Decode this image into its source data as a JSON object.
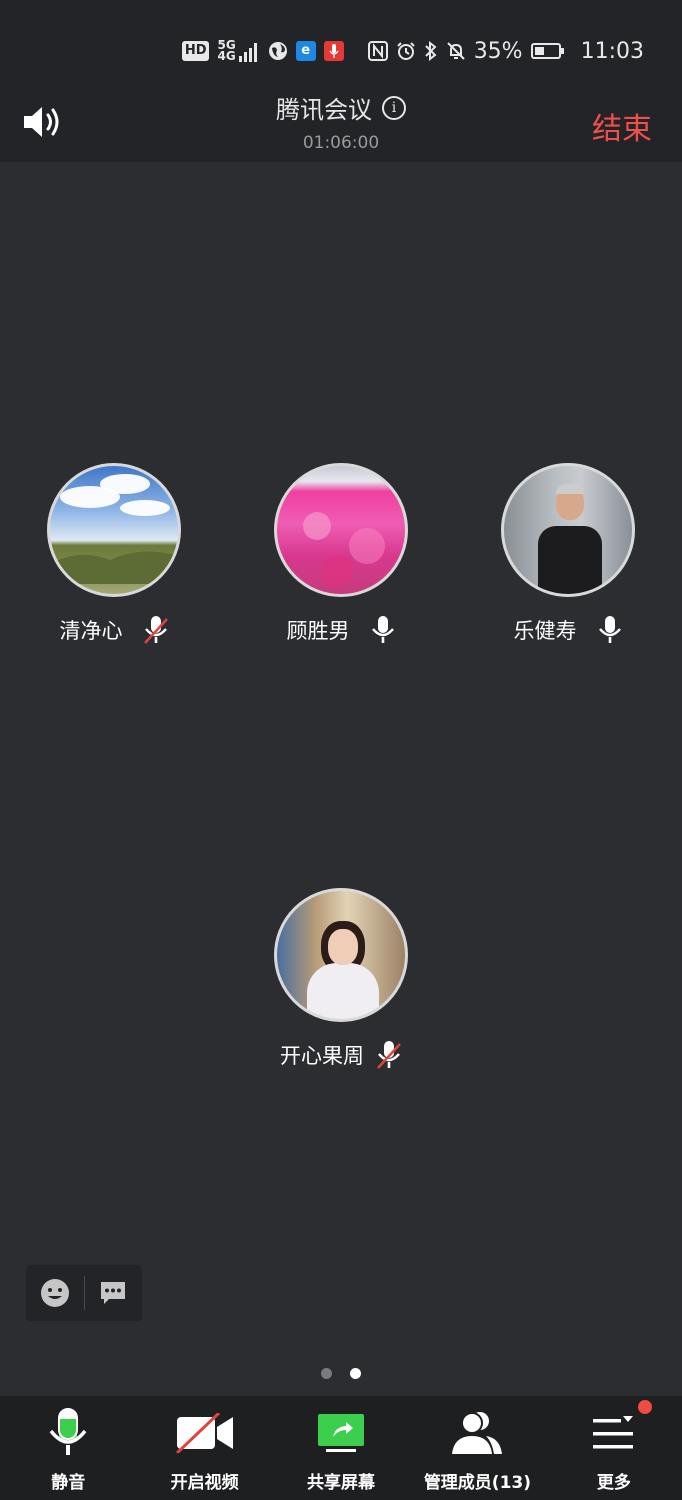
{
  "status_bar": {
    "hd": "HD",
    "signal_top": "5G",
    "signal_bottom": "4G",
    "battery_percent": "35%",
    "battery_level": 0.35,
    "time": "11:03"
  },
  "header": {
    "speaker_icon": "speaker-icon",
    "title": "腾讯会议",
    "info_icon": "i",
    "timer": "01:06:00",
    "end_label": "结束",
    "end_color": "#f0504a"
  },
  "participants": [
    {
      "name": "清净心",
      "mic": "muted",
      "avatar": "sky-landscape"
    },
    {
      "name": "顾胜男",
      "mic": "on",
      "avatar": "pink-flower-field"
    },
    {
      "name": "乐健寿",
      "mic": "on",
      "avatar": "man-portrait"
    },
    {
      "name": "开心果周",
      "mic": "muted",
      "avatar": "woman-portrait"
    }
  ],
  "reactions": {
    "emoji_icon": "emoji-icon",
    "chat_icon": "chat-icon"
  },
  "pagination": {
    "pages": 2,
    "current": 2
  },
  "toolbar": {
    "mute_label": "静音",
    "video_label": "开启视频",
    "share_label": "共享屏幕",
    "members_label": "管理成员(13)",
    "more_label": "更多",
    "accent_green": "#3ccf4e"
  }
}
